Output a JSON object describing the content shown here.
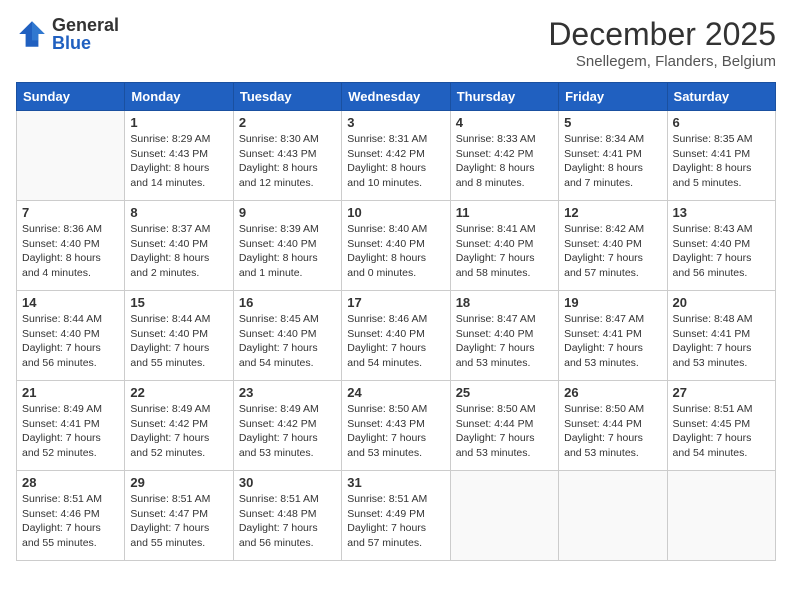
{
  "header": {
    "logo_general": "General",
    "logo_blue": "Blue",
    "month": "December 2025",
    "location": "Snellegem, Flanders, Belgium"
  },
  "weekdays": [
    "Sunday",
    "Monday",
    "Tuesday",
    "Wednesday",
    "Thursday",
    "Friday",
    "Saturday"
  ],
  "weeks": [
    [
      {
        "day": "",
        "info": ""
      },
      {
        "day": "1",
        "info": "Sunrise: 8:29 AM\nSunset: 4:43 PM\nDaylight: 8 hours\nand 14 minutes."
      },
      {
        "day": "2",
        "info": "Sunrise: 8:30 AM\nSunset: 4:43 PM\nDaylight: 8 hours\nand 12 minutes."
      },
      {
        "day": "3",
        "info": "Sunrise: 8:31 AM\nSunset: 4:42 PM\nDaylight: 8 hours\nand 10 minutes."
      },
      {
        "day": "4",
        "info": "Sunrise: 8:33 AM\nSunset: 4:42 PM\nDaylight: 8 hours\nand 8 minutes."
      },
      {
        "day": "5",
        "info": "Sunrise: 8:34 AM\nSunset: 4:41 PM\nDaylight: 8 hours\nand 7 minutes."
      },
      {
        "day": "6",
        "info": "Sunrise: 8:35 AM\nSunset: 4:41 PM\nDaylight: 8 hours\nand 5 minutes."
      }
    ],
    [
      {
        "day": "7",
        "info": "Sunrise: 8:36 AM\nSunset: 4:40 PM\nDaylight: 8 hours\nand 4 minutes."
      },
      {
        "day": "8",
        "info": "Sunrise: 8:37 AM\nSunset: 4:40 PM\nDaylight: 8 hours\nand 2 minutes."
      },
      {
        "day": "9",
        "info": "Sunrise: 8:39 AM\nSunset: 4:40 PM\nDaylight: 8 hours\nand 1 minute."
      },
      {
        "day": "10",
        "info": "Sunrise: 8:40 AM\nSunset: 4:40 PM\nDaylight: 8 hours\nand 0 minutes."
      },
      {
        "day": "11",
        "info": "Sunrise: 8:41 AM\nSunset: 4:40 PM\nDaylight: 7 hours\nand 58 minutes."
      },
      {
        "day": "12",
        "info": "Sunrise: 8:42 AM\nSunset: 4:40 PM\nDaylight: 7 hours\nand 57 minutes."
      },
      {
        "day": "13",
        "info": "Sunrise: 8:43 AM\nSunset: 4:40 PM\nDaylight: 7 hours\nand 56 minutes."
      }
    ],
    [
      {
        "day": "14",
        "info": "Sunrise: 8:44 AM\nSunset: 4:40 PM\nDaylight: 7 hours\nand 56 minutes."
      },
      {
        "day": "15",
        "info": "Sunrise: 8:44 AM\nSunset: 4:40 PM\nDaylight: 7 hours\nand 55 minutes."
      },
      {
        "day": "16",
        "info": "Sunrise: 8:45 AM\nSunset: 4:40 PM\nDaylight: 7 hours\nand 54 minutes."
      },
      {
        "day": "17",
        "info": "Sunrise: 8:46 AM\nSunset: 4:40 PM\nDaylight: 7 hours\nand 54 minutes."
      },
      {
        "day": "18",
        "info": "Sunrise: 8:47 AM\nSunset: 4:40 PM\nDaylight: 7 hours\nand 53 minutes."
      },
      {
        "day": "19",
        "info": "Sunrise: 8:47 AM\nSunset: 4:41 PM\nDaylight: 7 hours\nand 53 minutes."
      },
      {
        "day": "20",
        "info": "Sunrise: 8:48 AM\nSunset: 4:41 PM\nDaylight: 7 hours\nand 53 minutes."
      }
    ],
    [
      {
        "day": "21",
        "info": "Sunrise: 8:49 AM\nSunset: 4:41 PM\nDaylight: 7 hours\nand 52 minutes."
      },
      {
        "day": "22",
        "info": "Sunrise: 8:49 AM\nSunset: 4:42 PM\nDaylight: 7 hours\nand 52 minutes."
      },
      {
        "day": "23",
        "info": "Sunrise: 8:49 AM\nSunset: 4:42 PM\nDaylight: 7 hours\nand 53 minutes."
      },
      {
        "day": "24",
        "info": "Sunrise: 8:50 AM\nSunset: 4:43 PM\nDaylight: 7 hours\nand 53 minutes."
      },
      {
        "day": "25",
        "info": "Sunrise: 8:50 AM\nSunset: 4:44 PM\nDaylight: 7 hours\nand 53 minutes."
      },
      {
        "day": "26",
        "info": "Sunrise: 8:50 AM\nSunset: 4:44 PM\nDaylight: 7 hours\nand 53 minutes."
      },
      {
        "day": "27",
        "info": "Sunrise: 8:51 AM\nSunset: 4:45 PM\nDaylight: 7 hours\nand 54 minutes."
      }
    ],
    [
      {
        "day": "28",
        "info": "Sunrise: 8:51 AM\nSunset: 4:46 PM\nDaylight: 7 hours\nand 55 minutes."
      },
      {
        "day": "29",
        "info": "Sunrise: 8:51 AM\nSunset: 4:47 PM\nDaylight: 7 hours\nand 55 minutes."
      },
      {
        "day": "30",
        "info": "Sunrise: 8:51 AM\nSunset: 4:48 PM\nDaylight: 7 hours\nand 56 minutes."
      },
      {
        "day": "31",
        "info": "Sunrise: 8:51 AM\nSunset: 4:49 PM\nDaylight: 7 hours\nand 57 minutes."
      },
      {
        "day": "",
        "info": ""
      },
      {
        "day": "",
        "info": ""
      },
      {
        "day": "",
        "info": ""
      }
    ]
  ]
}
